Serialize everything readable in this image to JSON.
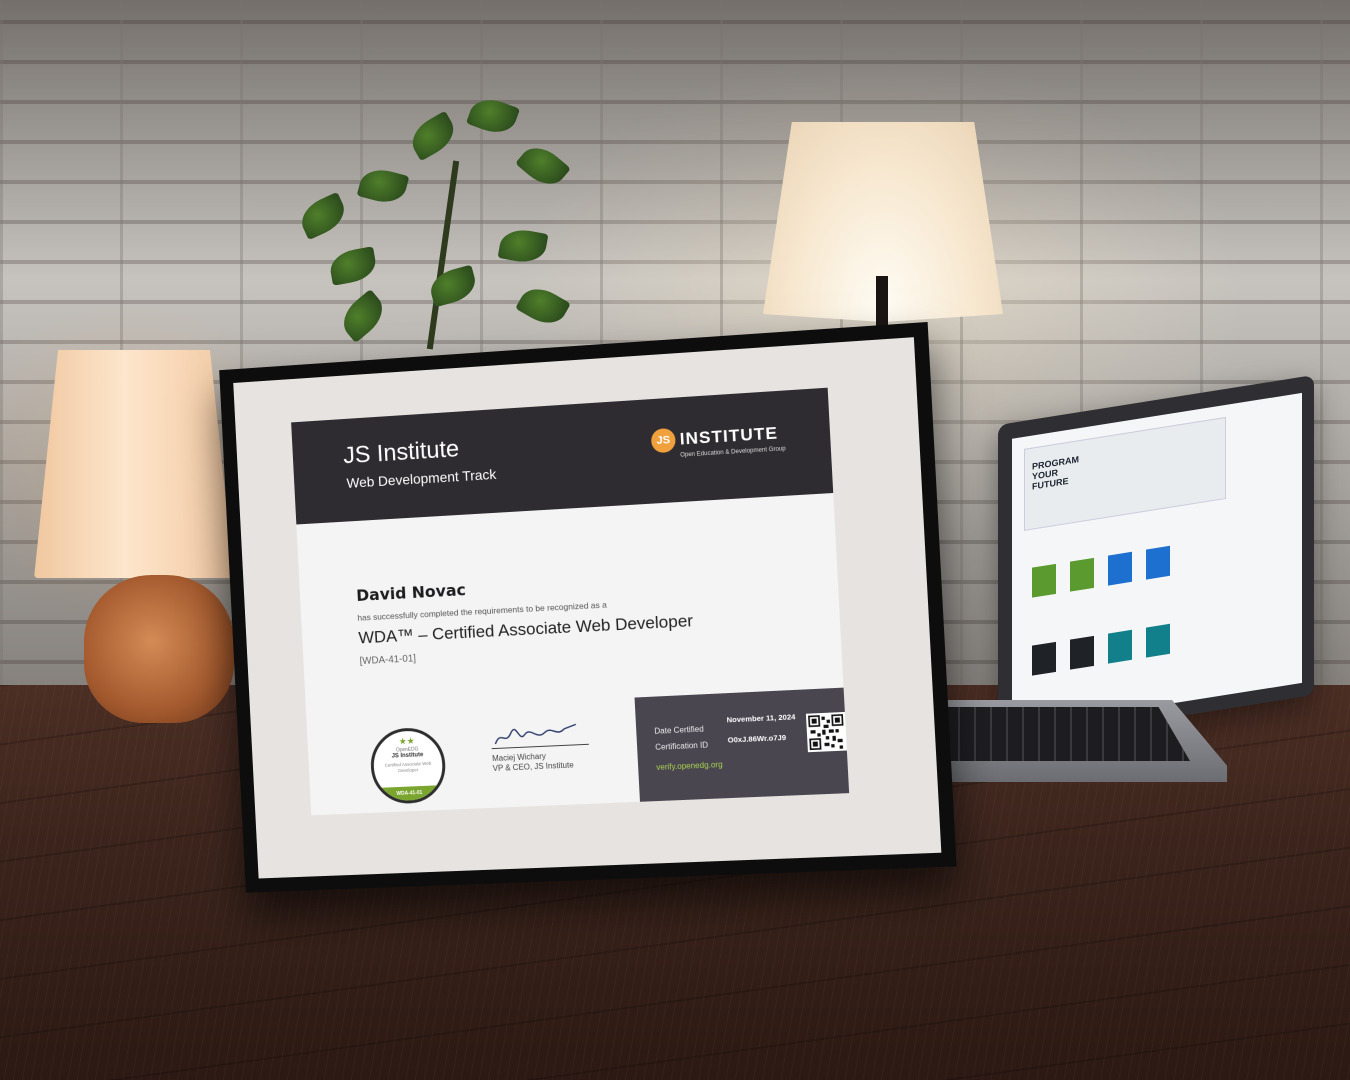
{
  "certificate": {
    "org_title": "JS Institute",
    "track": "Web Development Track",
    "brand": {
      "badge": "JS",
      "name": "INSTITUTE",
      "subtitle": "Open Education & Development Group"
    },
    "recipient": "David Novac",
    "statement": "has successfully completed the requirements to be recognized as a",
    "cert_name": "WDA™ – Certified Associate Web Developer",
    "cert_code": "[WDA-41-01]",
    "seal": {
      "stars": "★★",
      "org_small": "OpenEDG",
      "org": "JS Institute",
      "cert_text": "Certified Associate Web Developer",
      "code": "WDA-41-01"
    },
    "signer_name": "Maciej Wichary",
    "signer_role": "VP & CEO, JS Institute",
    "date_label": "Date Certified",
    "date_value": "November 11, 2024",
    "id_label": "Certification ID",
    "id_value": "O0xJ.86Wr.o7J9",
    "verify_link": "verify.openedg.org"
  },
  "laptop": {
    "heading": [
      "PROGRAM",
      "YOUR",
      "FUTURE"
    ]
  },
  "colors": {
    "header_dark": "#2f2c31",
    "verify_box": "#4a4650",
    "accent_green": "#7aa52e",
    "brand_orange": "#f0a03c"
  }
}
